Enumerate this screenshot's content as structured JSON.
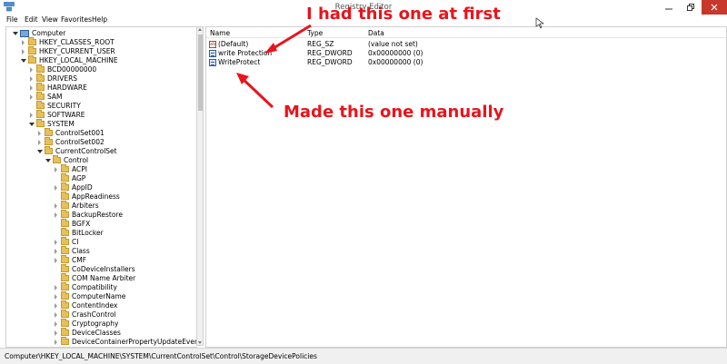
{
  "window": {
    "title": "Registry Editor"
  },
  "menu": [
    "File",
    "Edit",
    "View",
    "Favorites",
    "Help"
  ],
  "tree": [
    {
      "label": "Computer",
      "depth": 0,
      "state": "open",
      "icon": "computer"
    },
    {
      "label": "HKEY_CLASSES_ROOT",
      "depth": 1,
      "state": "closed",
      "icon": "folder"
    },
    {
      "label": "HKEY_CURRENT_USER",
      "depth": 1,
      "state": "closed",
      "icon": "folder"
    },
    {
      "label": "HKEY_LOCAL_MACHINE",
      "depth": 1,
      "state": "open",
      "icon": "folder"
    },
    {
      "label": "BCD00000000",
      "depth": 2,
      "state": "closed",
      "icon": "folder"
    },
    {
      "label": "DRIVERS",
      "depth": 2,
      "state": "closed",
      "icon": "folder"
    },
    {
      "label": "HARDWARE",
      "depth": 2,
      "state": "closed",
      "icon": "folder"
    },
    {
      "label": "SAM",
      "depth": 2,
      "state": "closed",
      "icon": "folder"
    },
    {
      "label": "SECURITY",
      "depth": 2,
      "state": "none",
      "icon": "folder"
    },
    {
      "label": "SOFTWARE",
      "depth": 2,
      "state": "closed",
      "icon": "folder"
    },
    {
      "label": "SYSTEM",
      "depth": 2,
      "state": "open",
      "icon": "folder"
    },
    {
      "label": "ControlSet001",
      "depth": 3,
      "state": "closed",
      "icon": "folder"
    },
    {
      "label": "ControlSet002",
      "depth": 3,
      "state": "closed",
      "icon": "folder"
    },
    {
      "label": "CurrentControlSet",
      "depth": 3,
      "state": "open",
      "icon": "folder"
    },
    {
      "label": "Control",
      "depth": 4,
      "state": "open",
      "icon": "folder"
    },
    {
      "label": "ACPI",
      "depth": 5,
      "state": "closed",
      "icon": "folder"
    },
    {
      "label": "AGP",
      "depth": 5,
      "state": "none",
      "icon": "folder"
    },
    {
      "label": "AppID",
      "depth": 5,
      "state": "closed",
      "icon": "folder"
    },
    {
      "label": "AppReadiness",
      "depth": 5,
      "state": "none",
      "icon": "folder"
    },
    {
      "label": "Arbiters",
      "depth": 5,
      "state": "closed",
      "icon": "folder"
    },
    {
      "label": "BackupRestore",
      "depth": 5,
      "state": "closed",
      "icon": "folder"
    },
    {
      "label": "BGFX",
      "depth": 5,
      "state": "none",
      "icon": "folder"
    },
    {
      "label": "BitLocker",
      "depth": 5,
      "state": "none",
      "icon": "folder"
    },
    {
      "label": "CI",
      "depth": 5,
      "state": "closed",
      "icon": "folder"
    },
    {
      "label": "Class",
      "depth": 5,
      "state": "closed",
      "icon": "folder"
    },
    {
      "label": "CMF",
      "depth": 5,
      "state": "closed",
      "icon": "folder"
    },
    {
      "label": "CoDeviceInstallers",
      "depth": 5,
      "state": "none",
      "icon": "folder"
    },
    {
      "label": "COM Name Arbiter",
      "depth": 5,
      "state": "none",
      "icon": "folder"
    },
    {
      "label": "Compatibility",
      "depth": 5,
      "state": "closed",
      "icon": "folder"
    },
    {
      "label": "ComputerName",
      "depth": 5,
      "state": "closed",
      "icon": "folder"
    },
    {
      "label": "ContentIndex",
      "depth": 5,
      "state": "closed",
      "icon": "folder"
    },
    {
      "label": "CrashControl",
      "depth": 5,
      "state": "closed",
      "icon": "folder"
    },
    {
      "label": "Cryptography",
      "depth": 5,
      "state": "closed",
      "icon": "folder"
    },
    {
      "label": "DeviceClasses",
      "depth": 5,
      "state": "closed",
      "icon": "folder"
    },
    {
      "label": "DeviceContainerPropertyUpdateEvents",
      "depth": 5,
      "state": "closed",
      "icon": "folder"
    }
  ],
  "list": {
    "columns": [
      "Name",
      "Type",
      "Data"
    ],
    "rows": [
      {
        "name": "(Default)",
        "type": "REG_SZ",
        "data": "(value not set)",
        "icon": "string"
      },
      {
        "name": "write Protection",
        "type": "REG_DWORD",
        "data": "0x00000000 (0)",
        "icon": "dword"
      },
      {
        "name": "WriteProtect",
        "type": "REG_DWORD",
        "data": "0x00000000 (0)",
        "icon": "dword"
      }
    ]
  },
  "status": {
    "path": "Computer\\HKEY_LOCAL_MACHINE\\SYSTEM\\CurrentControlSet\\Control\\StorageDevicePolicies"
  },
  "annotations": {
    "first": "I had this one at first",
    "second": "Made this one manually",
    "color": "#e8141c"
  }
}
